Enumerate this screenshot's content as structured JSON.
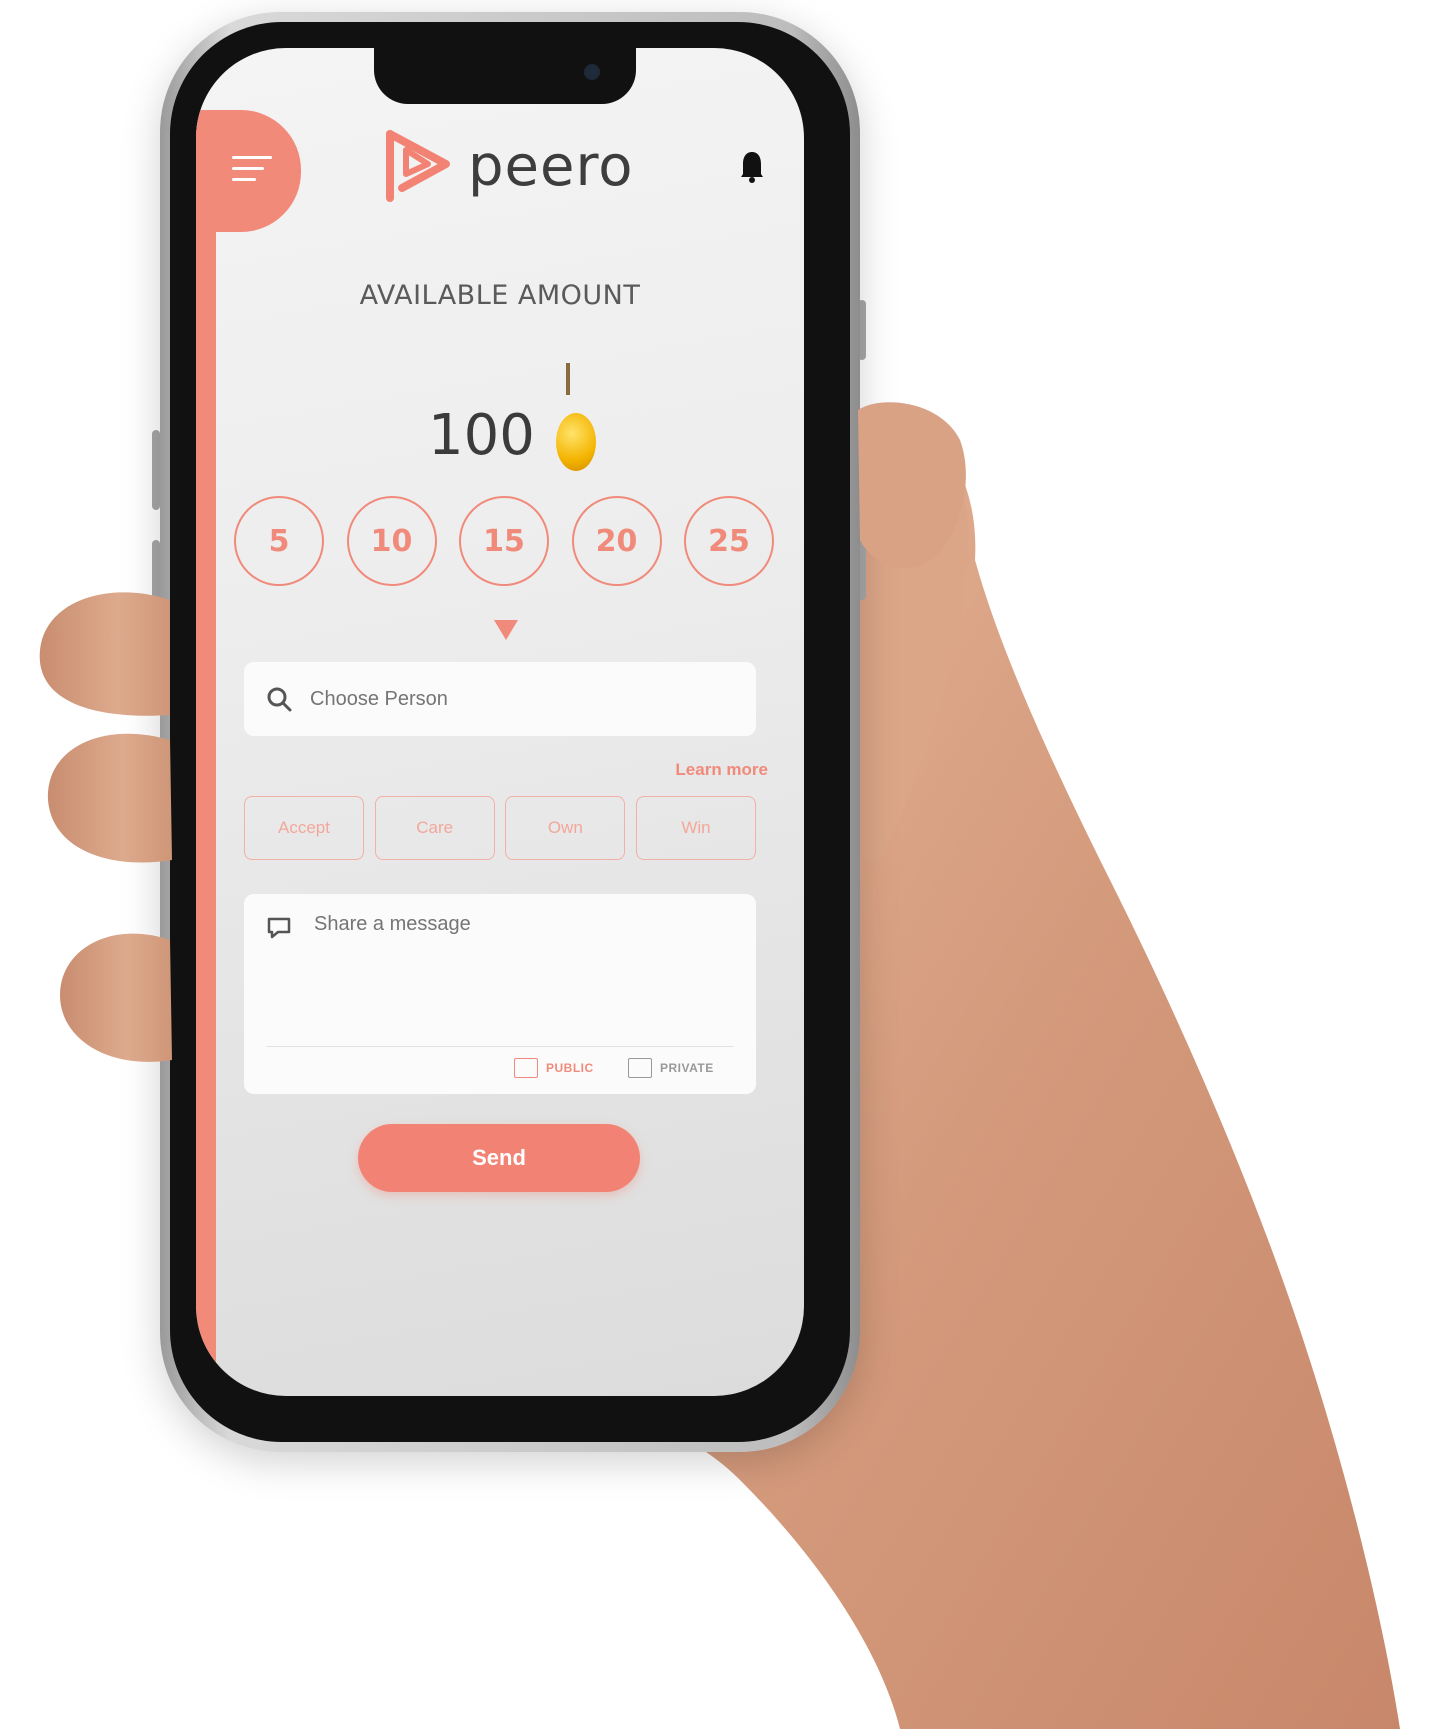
{
  "app": {
    "brand": "peero"
  },
  "wallet": {
    "label": "AVAILABLE AMOUNT",
    "amount": "100"
  },
  "amount_options": [
    "5",
    "10",
    "15",
    "20",
    "25"
  ],
  "search": {
    "placeholder": "Choose Person"
  },
  "learn_more": "Learn more",
  "values": [
    "Accept",
    "Care",
    "Own",
    "Win"
  ],
  "message": {
    "placeholder": "Share a message",
    "public_label": "PUBLIC",
    "private_label": "PRIVATE"
  },
  "send_label": "Send",
  "colors": {
    "accent": "#f28a7a",
    "coin": "#f4b400",
    "text_dark": "#3d3d3d"
  },
  "icons": {
    "menu": "hamburger-menu-icon",
    "bell": "bell-icon",
    "search": "search-icon",
    "message": "chat-bubble-icon",
    "coin": "coin-icon"
  }
}
